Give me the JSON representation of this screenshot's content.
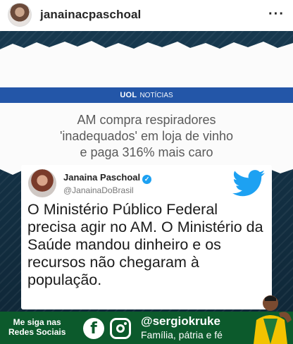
{
  "header": {
    "username": "janainacpaschoal",
    "more_label": "···",
    "avatar_icon": "profile-avatar-icon"
  },
  "news_card": {
    "source_logo": "UOL",
    "source_section": "NOTÍCIAS",
    "headline_lines": [
      "AM compra respiradores",
      "'inadequados' em loja de vinho",
      "e paga 316% mais caro"
    ],
    "accent_color": "#2356a8"
  },
  "tweet": {
    "name": "Janaina Paschoal",
    "handle": "@JanainaDoBrasil",
    "verified_icon": "verified-badge-icon",
    "platform_icon": "twitter-bird-icon",
    "text": "O Ministério Público Federal precisa agir no AM. O Ministério da Saúde mandou dinheiro e os recursos não chegaram à população.",
    "brand_color": "#1da1f2"
  },
  "footer": {
    "follow_line1": "Me siga nas",
    "follow_line2": "Redes Sociais",
    "facebook_icon": "f",
    "handle": "@sergiokruke",
    "tagline": "Família, pátria e fé",
    "background_color": "#0c5a2c"
  }
}
